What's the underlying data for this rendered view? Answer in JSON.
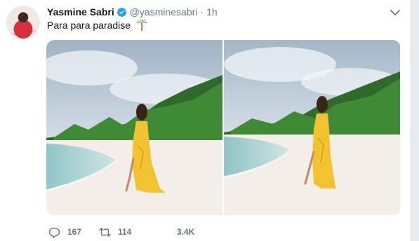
{
  "tweet": {
    "author_name": "Yasmine Sabri",
    "handle": "@yasminesabri",
    "separator": "·",
    "time": "1h",
    "text": "Para para paradise",
    "emoji": "palm-tree-icon",
    "verified": true
  },
  "media": {
    "photos": [
      {
        "name": "beach-photo-1"
      },
      {
        "name": "beach-photo-2"
      }
    ]
  },
  "actions": {
    "reply_count": "167",
    "retweet_count": "114",
    "like_count": "3.4K"
  },
  "colors": {
    "accent": "#1da1f2",
    "muted": "#657786",
    "text": "#14171a"
  }
}
